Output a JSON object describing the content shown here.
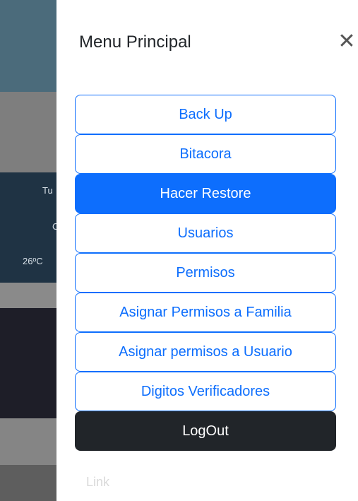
{
  "background": {
    "weather_day": "Tu",
    "weather_condition": "C",
    "weather_temp": "26ºC"
  },
  "offcanvas": {
    "title": "Menu Principal",
    "close_symbol": "✕",
    "menu": [
      {
        "label": "Back Up",
        "state": "outline"
      },
      {
        "label": "Bitacora",
        "state": "outline"
      },
      {
        "label": "Hacer Restore",
        "state": "active"
      },
      {
        "label": "Usuarios",
        "state": "outline"
      },
      {
        "label": "Permisos",
        "state": "outline"
      },
      {
        "label": "Asignar Permisos a Familia",
        "state": "outline"
      },
      {
        "label": "Asignar permisos a Usuario",
        "state": "outline"
      },
      {
        "label": "Digitos Verificadores",
        "state": "outline"
      },
      {
        "label": "LogOut",
        "state": "dark"
      }
    ],
    "link_label": "Link"
  },
  "colors": {
    "primary": "#0d6efd",
    "dark": "#212529"
  }
}
